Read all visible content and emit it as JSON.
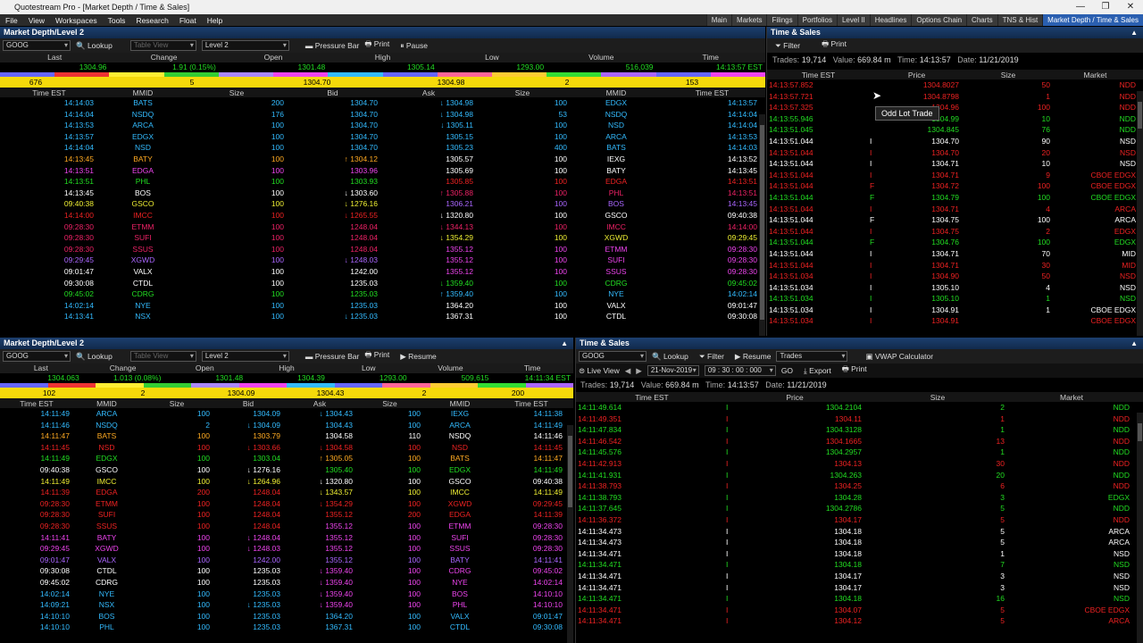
{
  "window": {
    "title": "Quotestream Pro - [Market Depth / Time & Sales]"
  },
  "menu": [
    "File",
    "View",
    "Workspaces",
    "Tools",
    "Research",
    "Float",
    "Help"
  ],
  "tabs": [
    "Main",
    "Markets",
    "Filings",
    "Portfolios",
    "Level II",
    "Headlines",
    "Options Chain",
    "Charts",
    "TNS & Hist",
    "Market Depth / Time & Sales"
  ],
  "colors": {
    "green": "#22dd22",
    "red": "#ee2222",
    "white": "#ffffff",
    "orange": "#ffaa22",
    "purple": "#aa66ff",
    "cyan": "#33bbff",
    "yellow": "#eeee33",
    "magenta": "#ee44ee",
    "pink": "#ff66aa"
  },
  "md1": {
    "title": "Market Depth/Level 2",
    "symbol": "GOOG",
    "lookup": "Lookup",
    "table_view": "Table View",
    "level": "Level 2",
    "pressure_bar": "Pressure Bar",
    "print": "Print",
    "pause": "Pause",
    "sum_labels": [
      "Last",
      "Change",
      "Open",
      "High",
      "Low",
      "Volume",
      "Time"
    ],
    "sum_values": [
      "1304.96",
      "1.91 (0.15%)",
      "1301.48",
      "1305.14",
      "1293.00",
      "516,039",
      "14:13:57 EST"
    ],
    "yellow": [
      "676",
      "5",
      "1304.70",
      "1304.98",
      "2",
      "153"
    ],
    "cols": [
      "Time EST",
      "MMID",
      "Size",
      "Bid",
      "Ask",
      "Size",
      "MMID",
      "Time EST"
    ],
    "rows": [
      [
        "14:14:03",
        "BATS",
        "200",
        "1304.70",
        "",
        "↓ 1304.98",
        "100",
        "EDGX",
        "14:13:57",
        "c",
        "c"
      ],
      [
        "14:14:04",
        "NSDQ",
        "176",
        "1304.70",
        "",
        "↓ 1304.98",
        "53",
        "NSDQ",
        "14:14:04",
        "c",
        "c"
      ],
      [
        "14:13:53",
        "ARCA",
        "100",
        "1304.70",
        "",
        "↓ 1305.11",
        "100",
        "NSD",
        "14:14:04",
        "c",
        "c"
      ],
      [
        "14:13:57",
        "EDGX",
        "100",
        "1304.70",
        "",
        "1305.15",
        "100",
        "ARCA",
        "14:13:53",
        "c",
        "c"
      ],
      [
        "14:14:04",
        "NSD",
        "100",
        "1304.70",
        "",
        "1305.23",
        "400",
        "BATS",
        "14:14:03",
        "c",
        "c"
      ],
      [
        "14:13:45",
        "BATY",
        "100",
        "↑ 1304.12",
        "",
        "1305.57",
        "100",
        "IEXG",
        "14:13:52",
        "o",
        "w"
      ],
      [
        "14:13:51",
        "EDGA",
        "100",
        "1303.96",
        "",
        "1305.69",
        "100",
        "BATY",
        "14:13:45",
        "m",
        "w"
      ],
      [
        "14:13:51",
        "PHL",
        "100",
        "1303.93",
        "",
        "1305.85",
        "100",
        "EDGA",
        "14:13:51",
        "g",
        "r"
      ],
      [
        "14:13:45",
        "BOS",
        "100",
        "↓ 1303.60",
        "",
        "↑ 1305.88",
        "100",
        "PHL",
        "14:13:51",
        "w",
        "b"
      ],
      [
        "09:40:38",
        "GSCO",
        "100",
        "↓ 1276.16",
        "",
        "1306.21",
        "100",
        "BOS",
        "14:13:45",
        "y",
        "p"
      ],
      [
        "14:14:00",
        "IMCC",
        "100",
        "↓ 1265.55",
        "",
        "↓ 1320.80",
        "100",
        "GSCO",
        "09:40:38",
        "r",
        "w"
      ],
      [
        "09:28:30",
        "ETMM",
        "100",
        "1248.04",
        "",
        "↓ 1344.13",
        "100",
        "IMCC",
        "14:14:00",
        "b",
        "b"
      ],
      [
        "09:28:30",
        "SUFI",
        "100",
        "1248.04",
        "",
        "↓ 1354.29",
        "100",
        "XGWD",
        "09:29:45",
        "b",
        "y"
      ],
      [
        "09:28:30",
        "SSUS",
        "100",
        "1248.04",
        "",
        "1355.12",
        "100",
        "ETMM",
        "09:28:30",
        "b",
        "m"
      ],
      [
        "09:29:45",
        "XGWD",
        "100",
        "↓ 1248.03",
        "",
        "1355.12",
        "100",
        "SUFI",
        "09:28:30",
        "p",
        "m"
      ],
      [
        "09:01:47",
        "VALX",
        "100",
        "1242.00",
        "",
        "1355.12",
        "100",
        "SSUS",
        "09:28:30",
        "w",
        "m"
      ],
      [
        "09:30:08",
        "CTDL",
        "100",
        "1235.03",
        "",
        "↓ 1359.40",
        "100",
        "CDRG",
        "09:45:02",
        "w",
        "g"
      ],
      [
        "09:45:02",
        "CDRG",
        "100",
        "1235.03",
        "",
        "↑ 1359.40",
        "100",
        "NYE",
        "14:02:14",
        "g",
        "c"
      ],
      [
        "14:02:14",
        "NYE",
        "100",
        "1235.03",
        "",
        "1364.20",
        "100",
        "VALX",
        "09:01:47",
        "c",
        "w"
      ],
      [
        "14:13:41",
        "NSX",
        "100",
        "↓ 1235.03",
        "",
        "1367.31",
        "100",
        "CTDL",
        "09:30:08",
        "c",
        "w"
      ]
    ]
  },
  "ts1": {
    "title": "Time & Sales",
    "filter": "Filter",
    "print": "Print",
    "trades_label": "Trades:",
    "trades": "19,714",
    "value_label": "Value:",
    "value": "669.84 m",
    "time_label": "Time:",
    "time": "14:13:57",
    "date_label": "Date:",
    "date": "11/21/2019",
    "cols": [
      "Time EST",
      "Price",
      "Size",
      "Market"
    ],
    "tooltip": "Odd Lot Trade",
    "rows": [
      [
        "14:13:57.852",
        "",
        "1304.8027",
        "50",
        "NDD",
        "r"
      ],
      [
        "14:13:57.721",
        "",
        "1304.8798",
        "1",
        "NDD",
        "r"
      ],
      [
        "14:13:57.325",
        "",
        "1304.96",
        "100",
        "NDD",
        "r"
      ],
      [
        "14:13:55.946",
        "",
        "1304.99",
        "10",
        "NDD",
        "g"
      ],
      [
        "14:13:51.045",
        "",
        "1304.845",
        "76",
        "NDD",
        "g"
      ],
      [
        "14:13:51.044",
        "I",
        "1304.70",
        "90",
        "NSD",
        "w"
      ],
      [
        "14:13:51.044",
        "I",
        "1304.70",
        "20",
        "NSD",
        "r"
      ],
      [
        "14:13:51.044",
        "I",
        "1304.71",
        "10",
        "NSD",
        "w"
      ],
      [
        "14:13:51.044",
        "I",
        "1304.71",
        "9",
        "CBOE EDGX",
        "r"
      ],
      [
        "14:13:51.044",
        "F",
        "1304.72",
        "100",
        "CBOE EDGX",
        "r"
      ],
      [
        "14:13:51.044",
        "F",
        "1304.79",
        "100",
        "CBOE EDGX",
        "g"
      ],
      [
        "14:13:51.044",
        "I",
        "1304.71",
        "4",
        "ARCA",
        "r"
      ],
      [
        "14:13:51.044",
        "F",
        "1304.75",
        "100",
        "ARCA",
        "w"
      ],
      [
        "14:13:51.044",
        "I",
        "1304.75",
        "2",
        "EDGX",
        "r"
      ],
      [
        "14:13:51.044",
        "F",
        "1304.76",
        "100",
        "EDGX",
        "g"
      ],
      [
        "14:13:51.044",
        "I",
        "1304.71",
        "70",
        "MID",
        "w"
      ],
      [
        "14:13:51.044",
        "I",
        "1304.71",
        "30",
        "MID",
        "r"
      ],
      [
        "14:13:51.034",
        "I",
        "1304.90",
        "50",
        "NSD",
        "r"
      ],
      [
        "14:13:51.034",
        "I",
        "1305.10",
        "4",
        "NSD",
        "w"
      ],
      [
        "14:13:51.034",
        "I",
        "1305.10",
        "1",
        "NSD",
        "g"
      ],
      [
        "14:13:51.034",
        "I",
        "1304.91",
        "1",
        "CBOE EDGX",
        "w"
      ],
      [
        "14:13:51.034",
        "I",
        "1304.91",
        "",
        "CBOE EDGX",
        "r"
      ]
    ]
  },
  "md2": {
    "title": "Market Depth/Level 2",
    "symbol": "GOOG",
    "lookup": "Lookup",
    "table_view": "Table View",
    "level": "Level 2",
    "pressure_bar": "Pressure Bar",
    "print": "Print",
    "resume": "Resume",
    "sum_labels": [
      "Last",
      "Change",
      "Open",
      "High",
      "Low",
      "Volume",
      "Time"
    ],
    "sum_values": [
      "1304.063",
      "1.013 (0.08%)",
      "1301.48",
      "1304.39",
      "1293.00",
      "509,615",
      "14:11:34 EST"
    ],
    "yellow": [
      "102",
      "2",
      "1304.09",
      "1304.43",
      "2",
      "200"
    ],
    "cols": [
      "Time EST",
      "MMID",
      "Size",
      "Bid",
      "Ask",
      "Size",
      "MMID",
      "Time EST"
    ],
    "rows": [
      [
        "14:11:49",
        "ARCA",
        "100",
        "1304.09",
        "",
        "↓ 1304.43",
        "100",
        "IEXG",
        "14:11:38",
        "c",
        "c"
      ],
      [
        "14:11:46",
        "NSDQ",
        "2",
        "↓ 1304.09",
        "",
        "1304.43",
        "100",
        "ARCA",
        "14:11:49",
        "c",
        "c"
      ],
      [
        "14:11:47",
        "BATS",
        "100",
        "1303.79",
        "",
        "1304.58",
        "110",
        "NSDQ",
        "14:11:46",
        "o",
        "w"
      ],
      [
        "14:11:45",
        "NSD",
        "100",
        "↓ 1303.66",
        "",
        "↓ 1304.58",
        "100",
        "NSD",
        "14:11:45",
        "r",
        "r"
      ],
      [
        "14:11:49",
        "EDGX",
        "100",
        "1303.04",
        "",
        "↑ 1305.05",
        "100",
        "BATS",
        "14:11:47",
        "g",
        "o"
      ],
      [
        "09:40:38",
        "GSCO",
        "100",
        "↓ 1276.16",
        "",
        "1305.40",
        "100",
        "EDGX",
        "14:11:49",
        "w",
        "g"
      ],
      [
        "14:11:49",
        "IMCC",
        "100",
        "↓ 1264.96",
        "",
        "↓ 1320.80",
        "100",
        "GSCO",
        "09:40:38",
        "y",
        "w"
      ],
      [
        "14:11:39",
        "EDGA",
        "200",
        "1248.04",
        "",
        "↓ 1343.57",
        "100",
        "IMCC",
        "14:11:49",
        "r",
        "y"
      ],
      [
        "09:28:30",
        "ETMM",
        "100",
        "1248.04",
        "",
        "↓ 1354.29",
        "100",
        "XGWD",
        "09:29:45",
        "r",
        "r"
      ],
      [
        "09:28:30",
        "SUFI",
        "100",
        "1248.04",
        "",
        "1355.12",
        "200",
        "EDGA",
        "14:11:39",
        "r",
        "r"
      ],
      [
        "09:28:30",
        "SSUS",
        "100",
        "1248.04",
        "",
        "1355.12",
        "100",
        "ETMM",
        "09:28:30",
        "r",
        "m"
      ],
      [
        "14:11:41",
        "BATY",
        "100",
        "↓ 1248.04",
        "",
        "1355.12",
        "100",
        "SUFI",
        "09:28:30",
        "m",
        "m"
      ],
      [
        "09:29:45",
        "XGWD",
        "100",
        "↓ 1248.03",
        "",
        "1355.12",
        "100",
        "SSUS",
        "09:28:30",
        "m",
        "m"
      ],
      [
        "09:01:47",
        "VALX",
        "100",
        "1242.00",
        "",
        "1355.12",
        "100",
        "BATY",
        "14:11:41",
        "p",
        "p"
      ],
      [
        "09:30:08",
        "CTDL",
        "100",
        "1235.03",
        "",
        "↓ 1359.40",
        "100",
        "CDRG",
        "09:45:02",
        "w",
        "m"
      ],
      [
        "09:45:02",
        "CDRG",
        "100",
        "1235.03",
        "",
        "↓ 1359.40",
        "100",
        "NYE",
        "14:02:14",
        "w",
        "m"
      ],
      [
        "14:02:14",
        "NYE",
        "100",
        "1235.03",
        "",
        "↓ 1359.40",
        "100",
        "BOS",
        "14:10:10",
        "c",
        "m"
      ],
      [
        "14:09:21",
        "NSX",
        "100",
        "↓ 1235.03",
        "",
        "↓ 1359.40",
        "100",
        "PHL",
        "14:10:10",
        "c",
        "m"
      ],
      [
        "14:10:10",
        "BOS",
        "100",
        "1235.03",
        "",
        "1364.20",
        "100",
        "VALX",
        "09:01:47",
        "c",
        "c"
      ],
      [
        "14:10:10",
        "PHL",
        "100",
        "1235.03",
        "",
        "1367.31",
        "100",
        "CTDL",
        "09:30:08",
        "c",
        "c"
      ]
    ]
  },
  "ts2": {
    "title": "Time & Sales",
    "symbol": "GOOG",
    "lookup": "Lookup",
    "filter": "Filter",
    "resume": "Resume",
    "trades_sel": "Trades",
    "vwap": "VWAP Calculator",
    "live_view": "Live View",
    "date_input": "21-Nov-2019",
    "time_input": "09 : 30 : 00 : 000",
    "go": "GO",
    "export": "Export",
    "print": "Print",
    "trades_label": "Trades:",
    "trades": "19,714",
    "value_label": "Value:",
    "value": "669.84 m",
    "time_label": "Time:",
    "time": "14:13:57",
    "date_label": "Date:",
    "date": "11/21/2019",
    "cols": [
      "Time EST",
      "Price",
      "Size",
      "Market"
    ],
    "rows": [
      [
        "14:11:49.614",
        "I",
        "1304.2104",
        "2",
        "NDD",
        "g"
      ],
      [
        "14:11:49.351",
        "I",
        "1304.11",
        "1",
        "NDD",
        "r"
      ],
      [
        "14:11:47.834",
        "I",
        "1304.3128",
        "1",
        "NDD",
        "g"
      ],
      [
        "14:11:46.542",
        "I",
        "1304.1665",
        "13",
        "NDD",
        "r"
      ],
      [
        "14:11:45.576",
        "I",
        "1304.2957",
        "1",
        "NDD",
        "g"
      ],
      [
        "14:11:42.913",
        "I",
        "1304.13",
        "30",
        "NDD",
        "r"
      ],
      [
        "14:11:41.931",
        "I",
        "1304.263",
        "20",
        "NDD",
        "g"
      ],
      [
        "14:11:38.793",
        "I",
        "1304.25",
        "6",
        "NDD",
        "r"
      ],
      [
        "14:11:38.793",
        "I",
        "1304.28",
        "3",
        "EDGX",
        "g"
      ],
      [
        "14:11:37.645",
        "I",
        "1304.2786",
        "5",
        "NDD",
        "g"
      ],
      [
        "14:11:36.372",
        "I",
        "1304.17",
        "5",
        "NDD",
        "r"
      ],
      [
        "14:11:34.473",
        "I",
        "1304.18",
        "5",
        "ARCA",
        "w"
      ],
      [
        "14:11:34.473",
        "I",
        "1304.18",
        "5",
        "ARCA",
        "w"
      ],
      [
        "14:11:34.471",
        "I",
        "1304.18",
        "1",
        "NSD",
        "w"
      ],
      [
        "14:11:34.471",
        "I",
        "1304.18",
        "7",
        "NSD",
        "g"
      ],
      [
        "14:11:34.471",
        "I",
        "1304.17",
        "3",
        "NSD",
        "w"
      ],
      [
        "14:11:34.471",
        "I",
        "1304.17",
        "3",
        "NSD",
        "w"
      ],
      [
        "14:11:34.471",
        "I",
        "1304.18",
        "16",
        "NSD",
        "g"
      ],
      [
        "14:11:34.471",
        "I",
        "1304.07",
        "5",
        "CBOE EDGX",
        "r"
      ],
      [
        "14:11:34.471",
        "I",
        "1304.12",
        "5",
        "ARCA",
        "r"
      ]
    ]
  }
}
